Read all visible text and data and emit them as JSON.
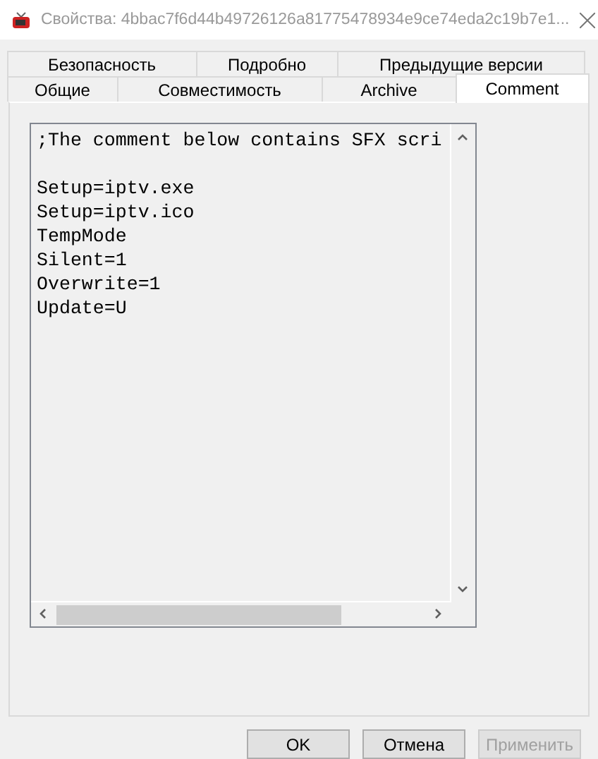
{
  "window": {
    "title": "Свойства: 4bbac7f6d44b49726126a81775478934e9ce74eda2c19b7e1..."
  },
  "tab_rows": [
    {
      "tabs": [
        {
          "label": "Безопасность",
          "selected": false
        },
        {
          "label": "Подробно",
          "selected": false
        },
        {
          "label": "Предыдущие версии",
          "selected": false
        }
      ]
    },
    {
      "tabs": [
        {
          "label": "Общие",
          "selected": false
        },
        {
          "label": "Совместимость",
          "selected": false
        },
        {
          "label": "Archive",
          "selected": false
        },
        {
          "label": "Comment",
          "selected": true
        }
      ]
    }
  ],
  "comment": {
    "first_line": ";The comment below contains SFX scri",
    "lines": [
      "Setup=iptv.exe",
      "Setup=iptv.ico",
      "TempMode",
      "Silent=1",
      "Overwrite=1",
      "Update=U"
    ]
  },
  "buttons": [
    {
      "label": "OK",
      "disabled": false
    },
    {
      "label": "Отмена",
      "disabled": false
    },
    {
      "label": "Применить",
      "disabled": true
    }
  ]
}
